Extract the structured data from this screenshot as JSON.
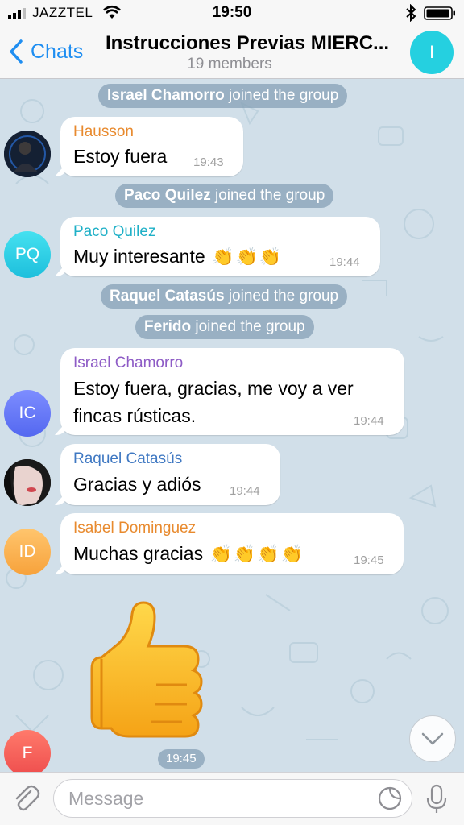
{
  "status_bar": {
    "carrier": "JAZZTEL",
    "time": "19:50"
  },
  "nav": {
    "back_label": "Chats",
    "title": "Instrucciones Previas MIERC...",
    "subtitle": "19 members",
    "avatar_initial": "I"
  },
  "messages": [
    {
      "type": "service",
      "name": "Israel Chamorro",
      "action": "joined the group"
    },
    {
      "type": "message",
      "sender": "Hausson",
      "text": "Estoy fuera",
      "time": "19:43"
    },
    {
      "type": "service",
      "name": "Paco Quilez",
      "action": "joined the group"
    },
    {
      "type": "message",
      "sender": "Paco Quilez",
      "avatar_initials": "PQ",
      "text": "Muy interesante",
      "time": "19:44"
    },
    {
      "type": "service",
      "name": "Raquel Catasús",
      "action": "joined the group"
    },
    {
      "type": "service",
      "name": "Ferido",
      "action": "joined the group"
    },
    {
      "type": "message",
      "sender": "Israel Chamorro",
      "avatar_initials": "IC",
      "text_line1": "Estoy fuera, gracias, me voy a ver",
      "text_line2": "fincas rústicas.",
      "time": "19:44"
    },
    {
      "type": "message",
      "sender": "Raquel Catasús",
      "text": "Gracias y adiós",
      "time": "19:44"
    },
    {
      "type": "message",
      "sender": "Isabel Dominguez",
      "avatar_initials": "ID",
      "text": "Muchas gracias",
      "time": "19:45"
    },
    {
      "type": "sticker",
      "sender_initial": "F",
      "time": "19:45"
    }
  ],
  "emoji": "👏",
  "input": {
    "placeholder": "Message"
  },
  "colors": {
    "link_blue": "#1f8ef1",
    "chat_background": "#d1dfe9",
    "name_hausson": "#e88a2e",
    "name_paco": "#1fb0c7",
    "name_israel": "#8e5cc6",
    "name_raquel": "#3f78c2",
    "name_isabel": "#e88a2e"
  }
}
